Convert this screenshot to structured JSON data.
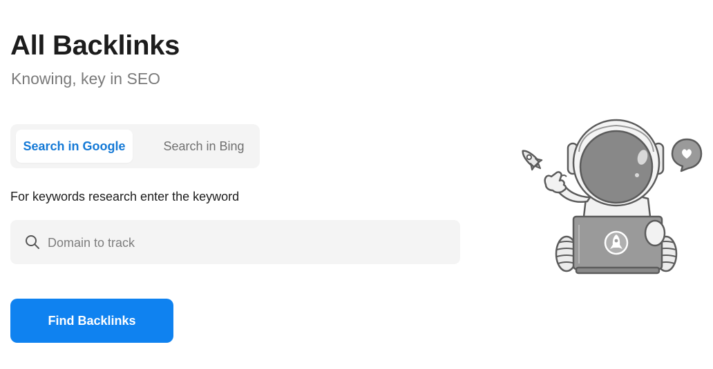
{
  "header": {
    "title": "All Backlinks",
    "subtitle": "Knowing, key in SEO"
  },
  "tabs": [
    {
      "label": "Search in Google",
      "active": true
    },
    {
      "label": "Search in Bing",
      "active": false
    }
  ],
  "form": {
    "prompt": "For keywords research enter the keyword",
    "search": {
      "placeholder": "Domain to track",
      "value": "",
      "icon": "search-icon"
    },
    "submit_label": "Find Backlinks"
  },
  "illustration": {
    "subject": "astronaut-with-laptop",
    "icons": [
      "rocket-icon",
      "heart-speech-bubble-icon"
    ]
  },
  "colors": {
    "accent": "#0f82f0",
    "active_tab_text": "#1479d6",
    "panel_bg": "#f4f4f4",
    "muted_text": "#7a7a7a"
  }
}
